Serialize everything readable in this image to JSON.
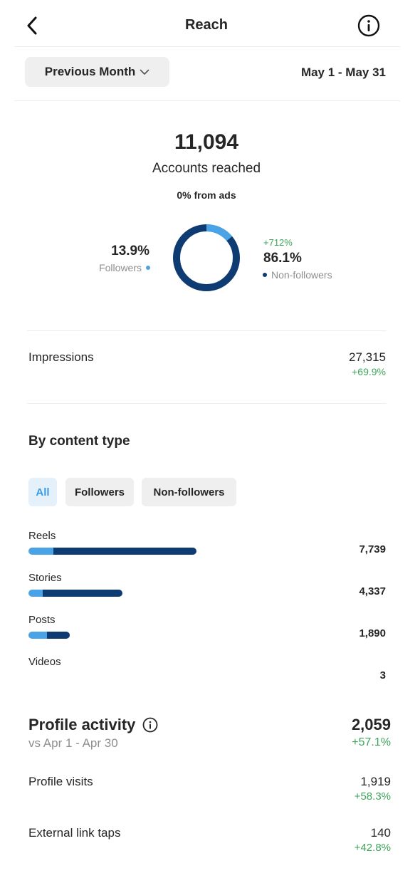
{
  "header": {
    "title": "Reach",
    "back_icon": "chevron-left-icon",
    "info_icon": "info-icon"
  },
  "filter": {
    "period_label": "Previous Month",
    "period_icon": "chevron-down-icon",
    "date_range": "May 1 - May 31"
  },
  "summary": {
    "accounts_reached": "11,094",
    "accounts_label": "Accounts reached",
    "ads_label": "0% from ads",
    "followers_pct": "13.9%",
    "followers_label": "Followers",
    "nonfollowers_change": "+712%",
    "nonfollowers_pct": "86.1%",
    "nonfollowers_label": "Non-followers",
    "followers_fraction": 0.139
  },
  "impressions": {
    "label": "Impressions",
    "value": "27,315",
    "change": "+69.9%"
  },
  "content_type": {
    "title": "By content type",
    "chips": [
      "All",
      "Followers",
      "Non-followers"
    ],
    "selected_chip": "All",
    "rows": [
      {
        "label": "Reels",
        "value": "7,739",
        "total": 7739,
        "followers_share": 0.15
      },
      {
        "label": "Stories",
        "value": "4,337",
        "total": 4337,
        "followers_share": 0.15
      },
      {
        "label": "Posts",
        "value": "1,890",
        "total": 1890,
        "followers_share": 0.45
      },
      {
        "label": "Videos",
        "value": "3",
        "total": 3,
        "followers_share": 0
      }
    ]
  },
  "profile_activity": {
    "title": "Profile activity",
    "info_icon": "info-icon",
    "subtitle": "vs Apr 1 - Apr 30",
    "value": "2,059",
    "change": "+57.1%",
    "rows": [
      {
        "label": "Profile visits",
        "value": "1,919",
        "change": "+58.3%"
      },
      {
        "label": "External link taps",
        "value": "140",
        "change": "+42.8%"
      }
    ]
  },
  "colors": {
    "followers": "#4aa3e6",
    "nonfollowers": "#0f3b73",
    "positive": "#3ea65a",
    "muted": "#8e8e8e"
  }
}
